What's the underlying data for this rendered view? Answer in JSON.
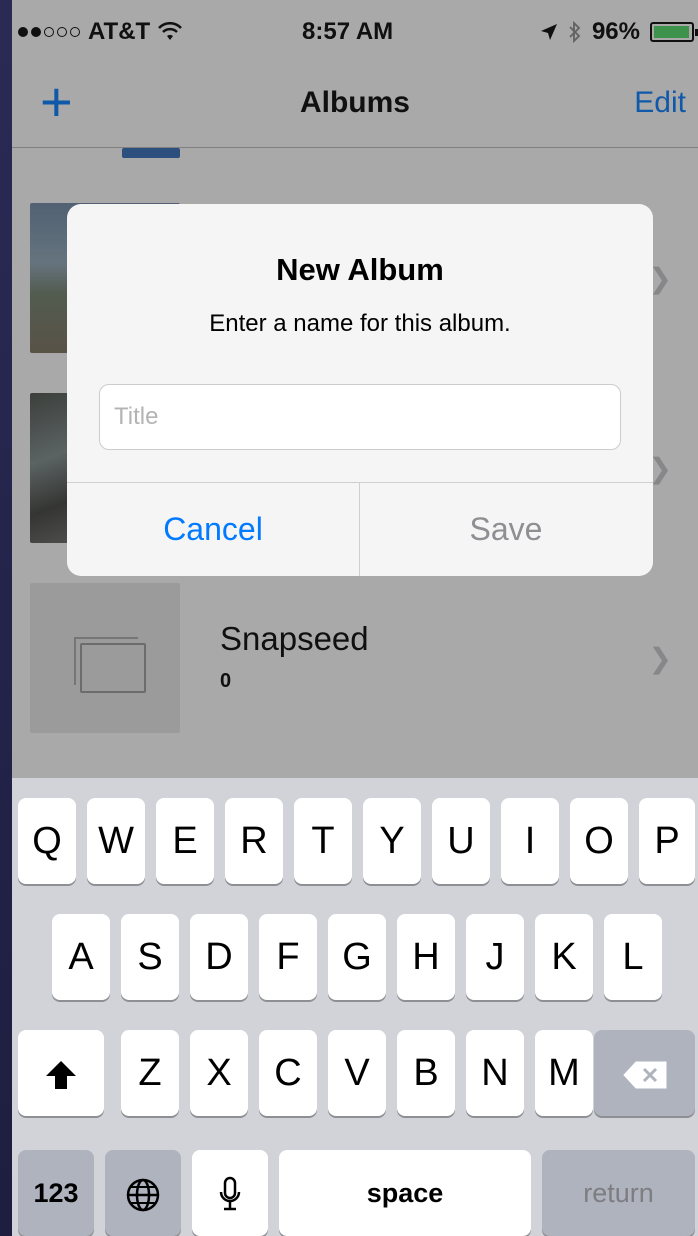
{
  "status_bar": {
    "carrier": "AT&T",
    "time": "8:57 AM",
    "battery": "96%",
    "battery_level": 0.96,
    "wifi_icon": "wifi-icon",
    "location_icon": "location-arrow-icon",
    "bluetooth_icon": "bluetooth-icon"
  },
  "nav": {
    "add_label": "+",
    "title": "Albums",
    "edit_label": "Edit"
  },
  "albums": [
    {
      "name": "",
      "count": ""
    },
    {
      "name": "",
      "count": ""
    },
    {
      "name": "Snapseed",
      "count": "0"
    }
  ],
  "alert": {
    "title": "New Album",
    "message": "Enter a name for this album.",
    "input_placeholder": "Title",
    "input_value": "",
    "cancel_label": "Cancel",
    "save_label": "Save"
  },
  "keyboard": {
    "row1": [
      "Q",
      "W",
      "E",
      "R",
      "T",
      "Y",
      "U",
      "I",
      "O",
      "P"
    ],
    "row2": [
      "A",
      "S",
      "D",
      "F",
      "G",
      "H",
      "J",
      "K",
      "L"
    ],
    "row3": [
      "Z",
      "X",
      "C",
      "V",
      "B",
      "N",
      "M"
    ],
    "numbers_label": "123",
    "space_label": "space",
    "return_label": "return",
    "shift_icon": "shift-arrow-icon",
    "delete_icon": "backspace-icon",
    "globe_icon": "globe-icon",
    "mic_icon": "microphone-icon"
  },
  "colors": {
    "accent": "#007aff",
    "disabled": "#8e8e93",
    "keyboard_bg": "#d1d3d8",
    "battery_fill": "#4cd964"
  }
}
